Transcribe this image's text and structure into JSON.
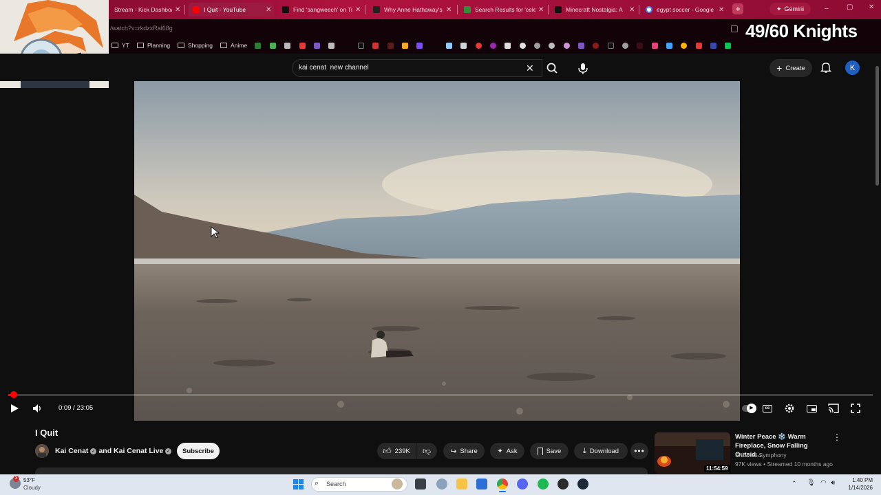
{
  "browser": {
    "tabs": [
      {
        "label": "Stream - Kick Dashboard",
        "favicon": "kick-icon",
        "color": "#53fc18"
      },
      {
        "label": "I Quit - YouTube",
        "favicon": "youtube-icon",
        "color": "#ff0000",
        "active": true
      },
      {
        "label": "Find 'sangweech' on TikTok",
        "favicon": "tiktok-icon",
        "color": "#111111"
      },
      {
        "label": "Why Anne Hathaway's",
        "favicon": "t-icon",
        "color": "#222222"
      },
      {
        "label": "Search Results for 'celeb",
        "favicon": "search-results-icon",
        "color": "#2d8f3a"
      },
      {
        "label": "Minecraft Nostalgia: A",
        "favicon": "tiktok-icon",
        "color": "#111111"
      },
      {
        "label": "egypt soccer - Google",
        "favicon": "google-icon",
        "color": "#4285f4"
      }
    ],
    "new_tab_symbol": "+",
    "gemini_label": "Gemini",
    "url": "/watch?v=rkdzxRal68g",
    "bookmarks": [
      {
        "label": "YT",
        "type": "folder"
      },
      {
        "label": "Planning",
        "type": "folder"
      },
      {
        "label": "Shopping",
        "type": "folder"
      },
      {
        "label": "Anime",
        "type": "folder"
      }
    ]
  },
  "overlay": {
    "knights_counter": "49/60 Knights"
  },
  "youtube": {
    "search_query": "kai cenat  new channel",
    "create_label": "Create",
    "account_initial": "K",
    "player": {
      "time": "0:09 / 23:05",
      "progress_fraction": 0.0065
    },
    "video": {
      "title": "I Quit",
      "channel_name": "Kai Cenat",
      "channel_joiner": "and Kai Cenat Live",
      "subscribe_label": "Subscribe",
      "likes": "239K",
      "share_label": "Share",
      "ask_label": "Ask",
      "save_label": "Save",
      "download_label": "Download"
    },
    "recommendation": {
      "title": "Winter Peace ❄️ Warm Fireplace, Snow Falling Outsid...",
      "channel": "Snowfall Symphony",
      "meta": "97K views • Streamed 10 months ago",
      "duration": "11:54:59"
    }
  },
  "taskbar": {
    "weather_temp": "53°F",
    "weather_condition": "Cloudy",
    "search_label": "Search",
    "notification_count": "3",
    "time": "1:40 PM",
    "date": "1/14/2026"
  }
}
